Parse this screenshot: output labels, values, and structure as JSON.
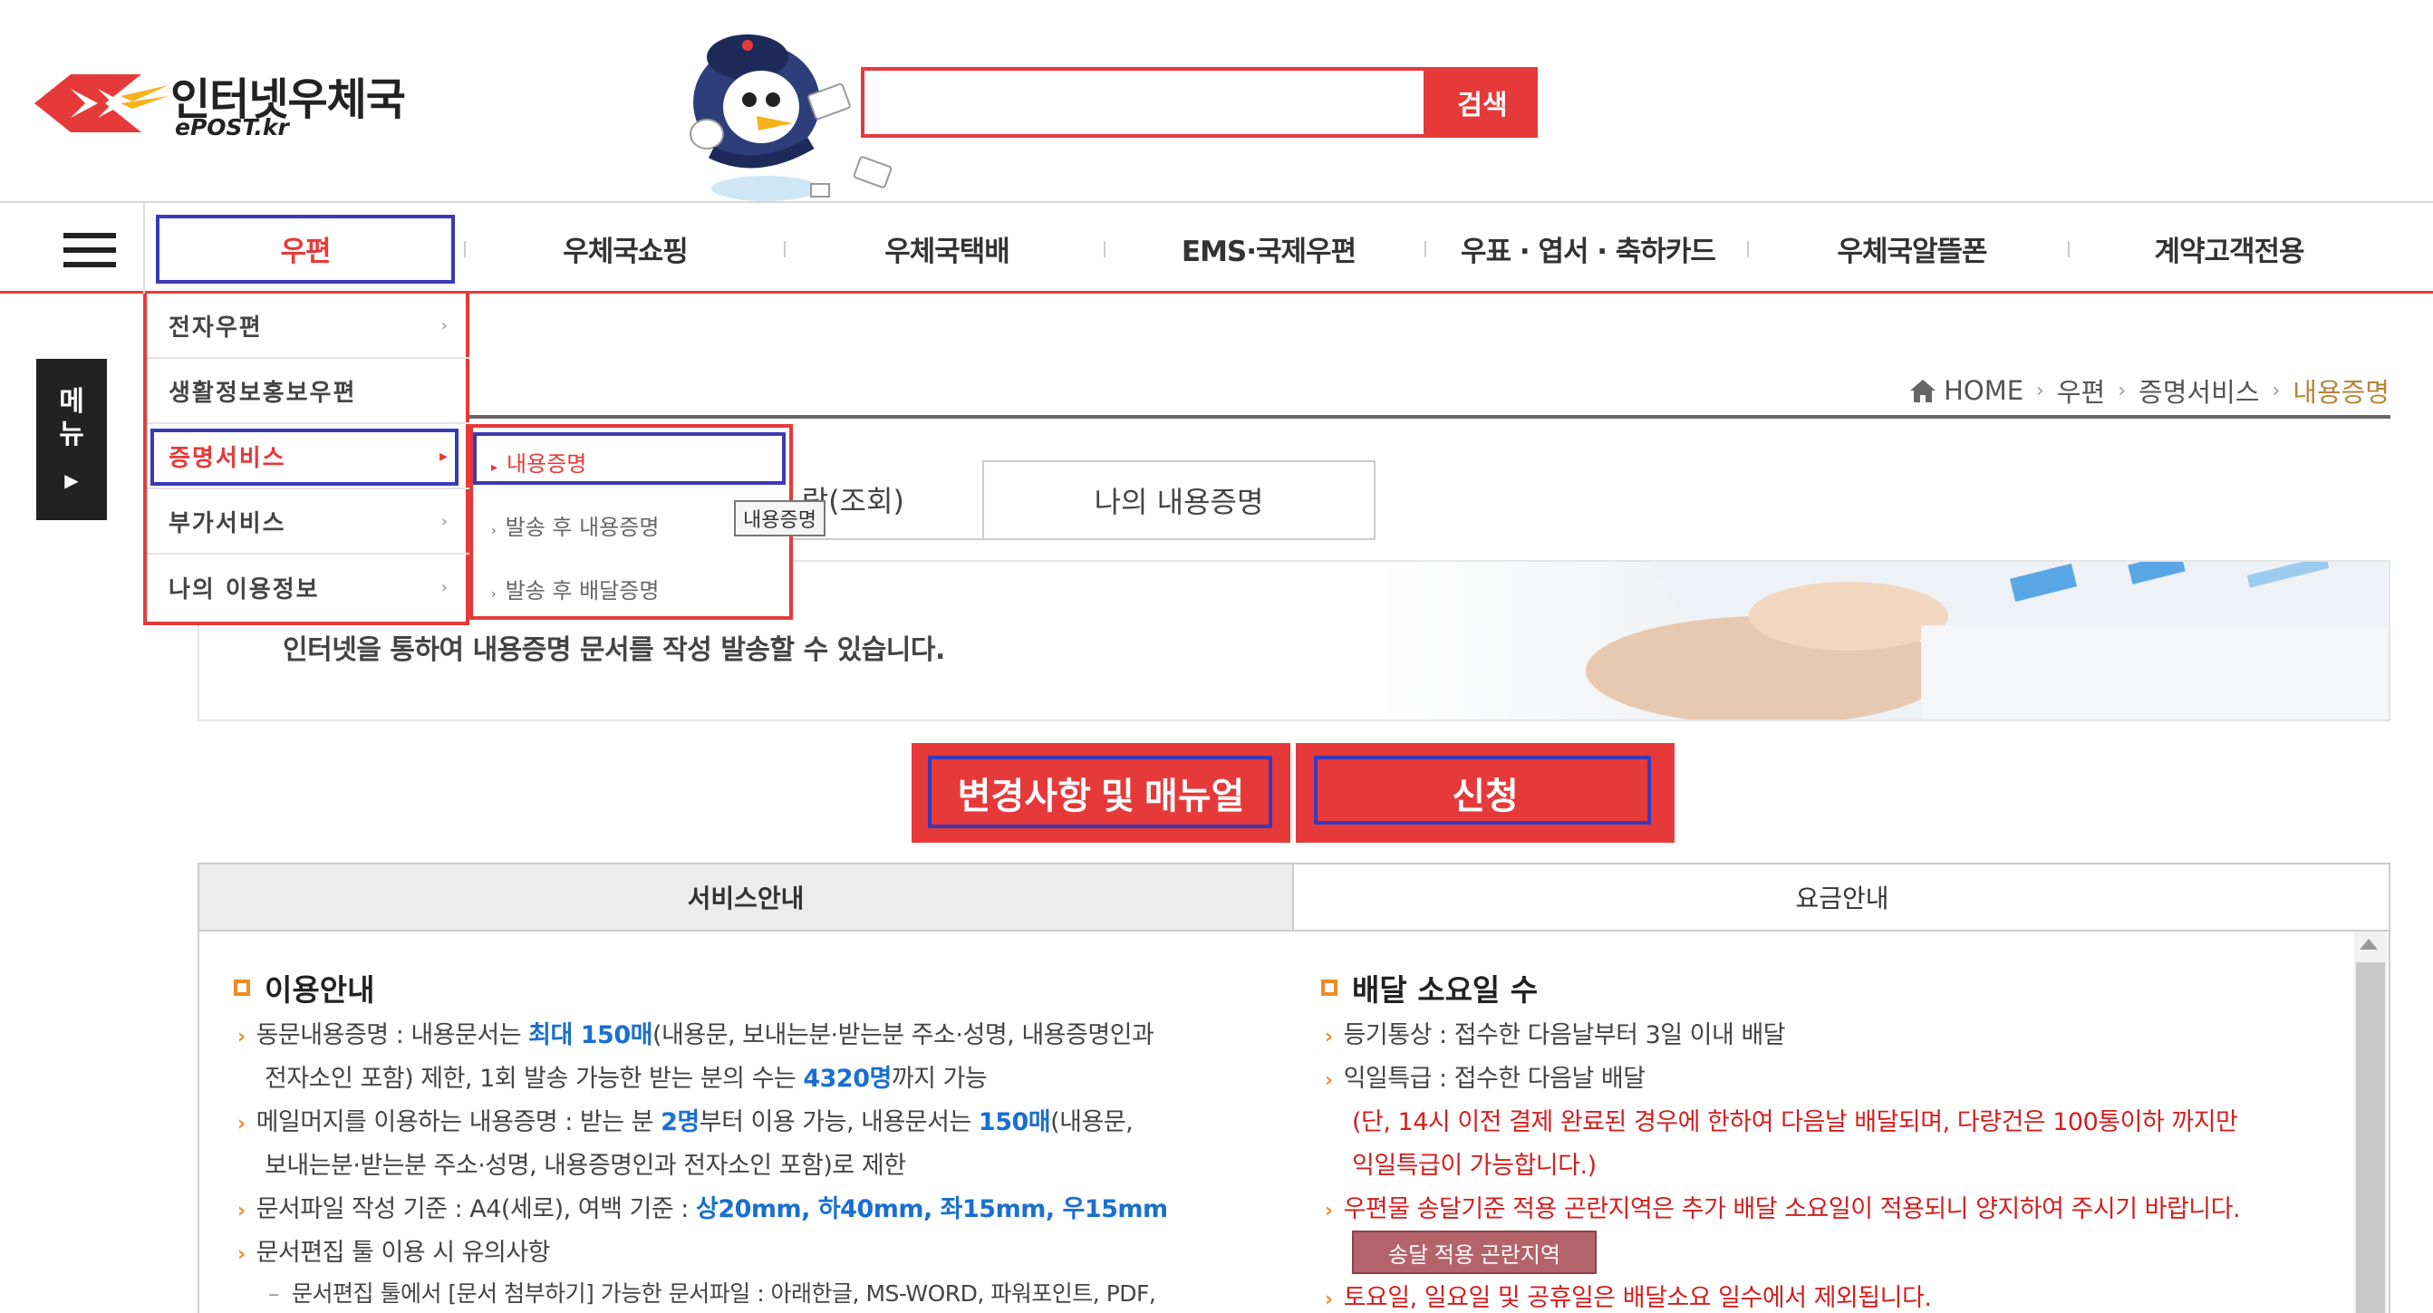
{
  "header": {
    "logo_title": "인터넷우체국",
    "logo_sub": "ePOST.kr",
    "search_button": "검색",
    "search_placeholder": ""
  },
  "gnb": {
    "items": [
      {
        "label": "우편",
        "active": true
      },
      {
        "label": "우체국쇼핑"
      },
      {
        "label": "우체국택배"
      },
      {
        "label": "EMS·국제우편"
      },
      {
        "label": "우표 · 엽서 · 축하카드"
      },
      {
        "label": "우체국알뜰폰"
      },
      {
        "label": "계약고객전용"
      }
    ]
  },
  "dropdown": {
    "items": [
      {
        "label": "전자우편"
      },
      {
        "label": "생활정보홍보우편"
      },
      {
        "label": "증명서비스",
        "active": true
      },
      {
        "label": "부가서비스"
      },
      {
        "label": "나의 이용정보"
      }
    ],
    "submenu": [
      {
        "label": "내용증명",
        "active": true
      },
      {
        "label": "발송 후 내용증명"
      },
      {
        "label": "발송 후 배달증명"
      }
    ],
    "tooltip": "내용증명"
  },
  "side_tab": {
    "label": "메뉴"
  },
  "breadcrumb": {
    "items": [
      "HOME",
      "우편",
      "증명서비스",
      "내용증명"
    ]
  },
  "tabs": {
    "partial": "람(조회)",
    "my": "나의 내용증명"
  },
  "banner": {
    "text": "인터넷을 통하여 내용증명 문서를 작성 발송할 수 있습니다."
  },
  "actions": {
    "manual": "변경사항 및 매뉴얼",
    "apply": "신청"
  },
  "info_tabs": {
    "service": "서비스안내",
    "fee": "요금안내"
  },
  "usage": {
    "title": "이용안내",
    "l1a": "동문내용증명 : 내용문서는 ",
    "l1b": "최대 150매",
    "l1c": "(내용문, 보내는분·받는분 주소·성명, 내용증명인과",
    "l2a": "전자소인 포함) 제한, 1회 발송 가능한 받는 분의 수는 ",
    "l2b": "4320명",
    "l2c": "까지 가능",
    "l3a": "메일머지를 이용하는 내용증명 : 받는 분 ",
    "l3b": "2명",
    "l3c": "부터 이용 가능, 내용문서는 ",
    "l3d": "150매",
    "l3e": "(내용문,",
    "l4": "보내는분·받는분 주소·성명, 내용증명인과 전자소인 포함)로 제한",
    "l5a": "문서파일 작성 기준 : A4(세로), 여백 기준 : ",
    "l5b": "상20mm, 하40mm, 좌15mm, 우15mm",
    "l6": "문서편집 툴 이용 시 유의사항",
    "l7": "문서편집 툴에서 [문서 첨부하기] 가능한 문서파일 : 아래한글, MS-WORD, 파워포인트, PDF,"
  },
  "delivery": {
    "title": "배달 소요일 수",
    "l1": "등기통상 : 접수한 다음날부터 3일 이내 배달",
    "l2": "익일특급 : 접수한 다음날 배달",
    "l3": "(단, 14시 이전 결제 완료된 경우에 한하여 다음날 배달되며, 다량건은 100통이하 까지만",
    "l4": "익일특급이 가능합니다.)",
    "l5": "우편물 송달기준 적용 곤란지역은 추가 배달 소요일이 적용되니 양지하여 주시기 바랍니다.",
    "btn": "송달 적용 곤란지역",
    "l6": "토요일, 일요일 및 공휴일은 배달소요 일수에서 제외됩니다."
  },
  "colors": {
    "brand_red": "#e63a3a",
    "highlight_blue": "#3a3ab8",
    "accent_orange": "#f08a24",
    "link_blue": "#1a6fd1",
    "breadcrumb_current": "#b5853a"
  }
}
